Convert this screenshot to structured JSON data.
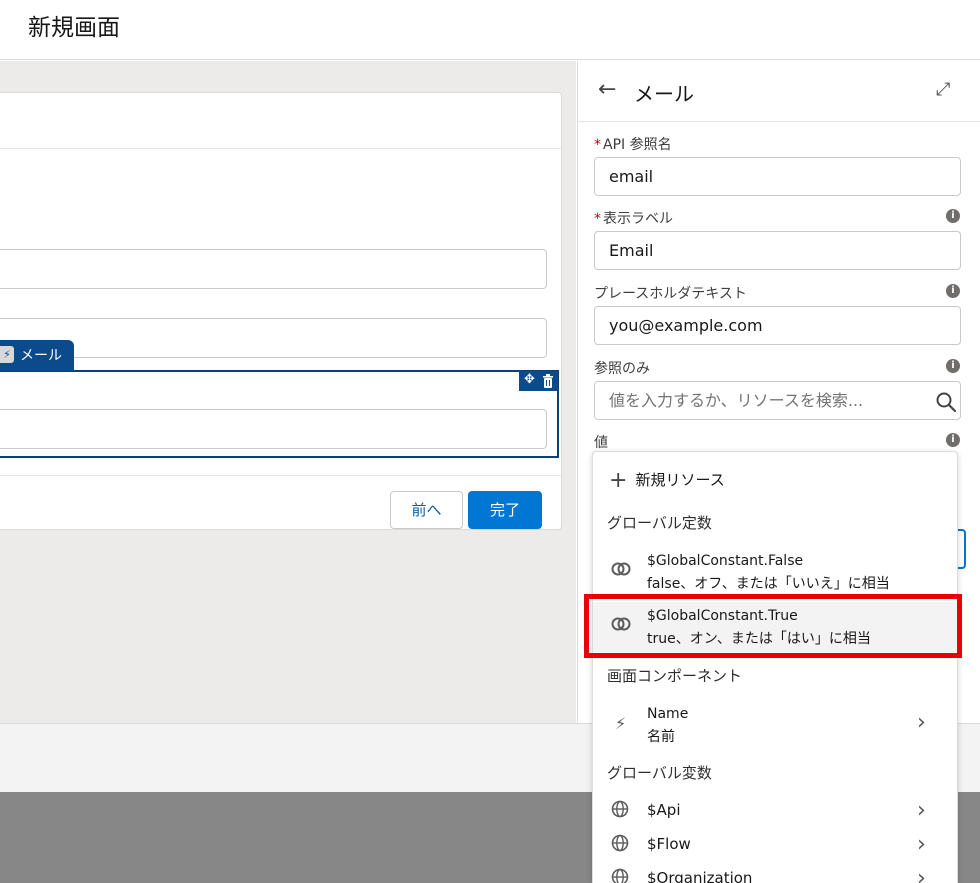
{
  "page": {
    "title": "新規画面"
  },
  "canvas": {
    "selected_component_label": "メール",
    "buttons": {
      "prev": "前へ",
      "done": "完了"
    }
  },
  "panel": {
    "title": "メール",
    "fields": [
      {
        "label": "API 参照名",
        "required": true,
        "value": "email"
      },
      {
        "label": "表示ラベル",
        "required": true,
        "value": "Email"
      },
      {
        "label": "プレースホルダテキスト",
        "required": false,
        "value": "you@example.com"
      },
      {
        "label": "参照のみ",
        "required": false,
        "placeholder": "値を入力するか、リソースを検索..."
      },
      {
        "label": "値",
        "required": false
      }
    ]
  },
  "dropdown": {
    "new_resource": "新規リソース",
    "sections": [
      {
        "title": "グローバル定数"
      },
      {
        "title": "画面コンポーネント"
      },
      {
        "title": "グローバル変数"
      }
    ],
    "items": {
      "false_const": {
        "name": "$GlobalConstant.False",
        "desc": "false、オフ、または「いいえ」に相当"
      },
      "true_const": {
        "name": "$GlobalConstant.True",
        "desc": "true、オン、または「はい」に相当"
      },
      "name_comp": {
        "name": "Name",
        "desc": "名前"
      },
      "api": {
        "name": "$Api"
      },
      "flow": {
        "name": "$Flow"
      },
      "org": {
        "name": "$Organization"
      }
    }
  },
  "colors": {
    "brand": "#0176d3",
    "highlight_border": "#e8000b",
    "selection": "#0b4b8c"
  },
  "icons": [
    "back-arrow-icon",
    "expand-icon",
    "info-icon",
    "search-icon",
    "plus-icon",
    "constant-icon",
    "bolt-icon",
    "globe-icon",
    "chevron-right-icon",
    "move-icon",
    "trash-icon"
  ]
}
